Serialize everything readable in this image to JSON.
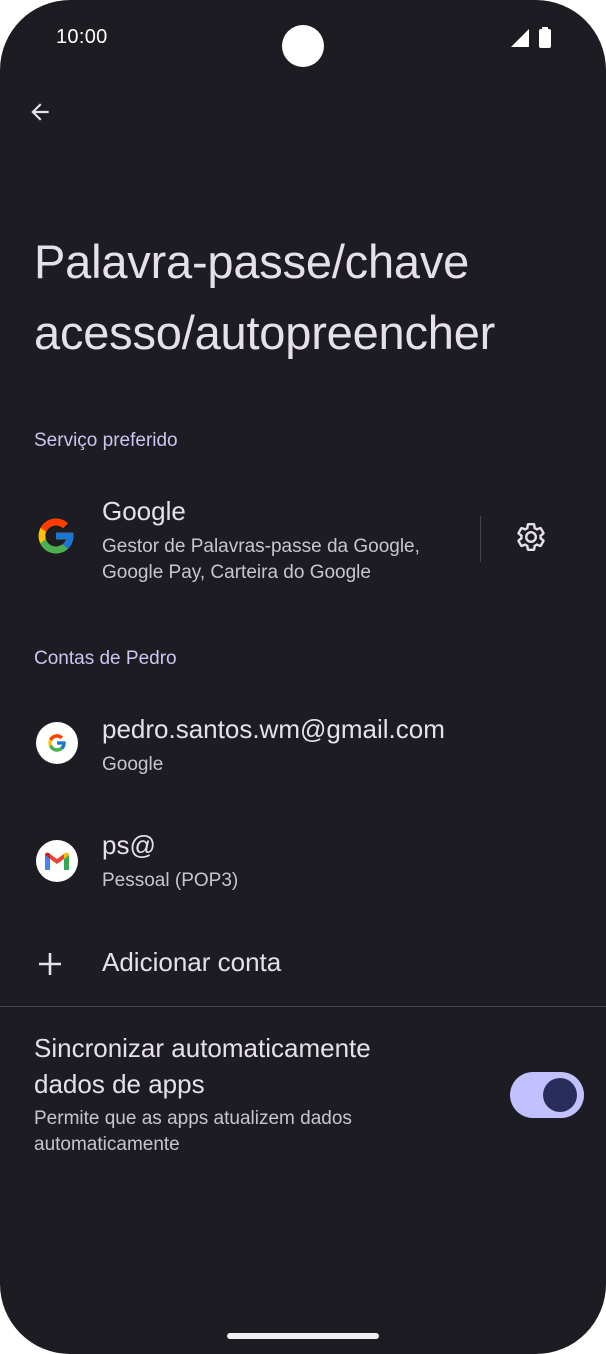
{
  "status_bar": {
    "time": "10:00",
    "signal_icon": "cellular-signal-icon",
    "battery_icon": "battery-icon"
  },
  "header": {
    "back_icon": "arrow-back-icon",
    "title_line1": "Palavra-passe/chave",
    "title_line2": "acesso/autopreencher"
  },
  "preferred_service": {
    "section_label": "Serviço preferido",
    "name": "Google",
    "description_line1": "Gestor de Palavras-passe da Google,",
    "description_line2": "Google Pay, Carteira do Google",
    "settings_icon": "gear-icon"
  },
  "accounts": {
    "section_label": "Contas de Pedro",
    "items": [
      {
        "title": "pedro.santos.wm@gmail.com",
        "subtitle": "Google",
        "icon": "google-icon"
      },
      {
        "title": "ps@",
        "subtitle": "Pessoal (POP3)",
        "icon": "gmail-icon"
      }
    ],
    "add_label": "Adicionar conta",
    "add_icon": "plus-icon"
  },
  "sync": {
    "title_line1": "Sincronizar automaticamente",
    "title_line2": "dados de apps",
    "description_line1": "Permite que as apps atualizem dados",
    "description_line2": "automaticamente",
    "enabled": true
  },
  "colors": {
    "background": "#1d1c22",
    "accent_label": "#cdc4f4",
    "toggle_track": "#c3c0ff",
    "toggle_knob": "#2a2d5c"
  }
}
